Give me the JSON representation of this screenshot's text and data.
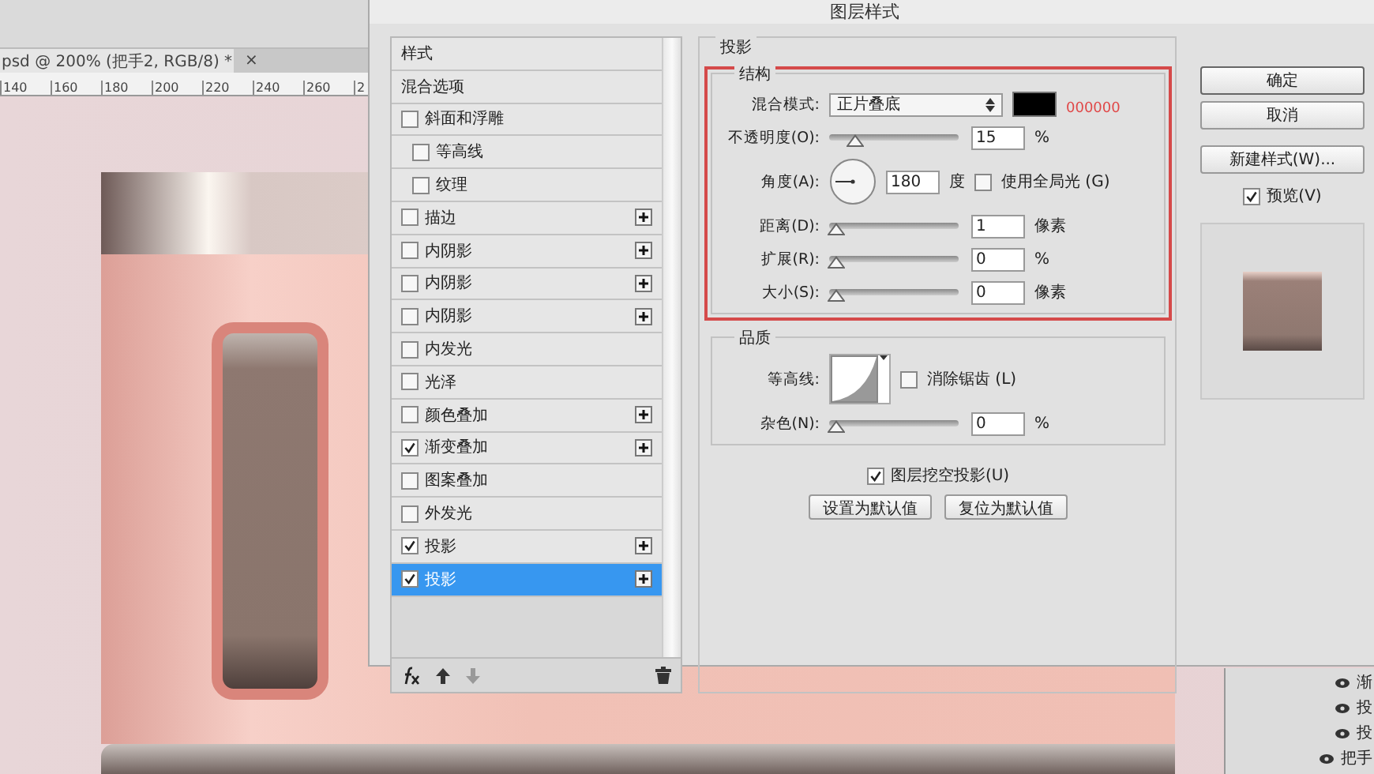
{
  "document": {
    "tab_title": "psd @ 200% (把手2, RGB/8) *",
    "tab_close": "×",
    "ruler_ticks": [
      "140",
      "160",
      "180",
      "200",
      "220",
      "240",
      "260",
      "2"
    ]
  },
  "layers_panel": {
    "rows": [
      {
        "label": "渐"
      },
      {
        "label": "投"
      },
      {
        "label": "投"
      },
      {
        "label": "把手"
      }
    ]
  },
  "dialog": {
    "title": "图层样式",
    "styles": [
      {
        "label": "样式",
        "kind": "header",
        "selected": false
      },
      {
        "label": "混合选项",
        "kind": "header",
        "selected": false
      },
      {
        "label": "斜面和浮雕",
        "kind": "check",
        "checked": false,
        "addable": false,
        "selected": false,
        "children": [
          {
            "label": "等高线",
            "kind": "check",
            "checked": false,
            "addable": false,
            "selected": false
          },
          {
            "label": "纹理",
            "kind": "check",
            "checked": false,
            "addable": false,
            "selected": false
          }
        ]
      },
      {
        "label": "描边",
        "kind": "check",
        "checked": false,
        "addable": true,
        "selected": false
      },
      {
        "label": "内阴影",
        "kind": "check",
        "checked": false,
        "addable": true,
        "selected": false
      },
      {
        "label": "内阴影",
        "kind": "check",
        "checked": false,
        "addable": true,
        "selected": false
      },
      {
        "label": "内阴影",
        "kind": "check",
        "checked": false,
        "addable": true,
        "selected": false
      },
      {
        "label": "内发光",
        "kind": "check",
        "checked": false,
        "addable": false,
        "selected": false
      },
      {
        "label": "光泽",
        "kind": "check",
        "checked": false,
        "addable": false,
        "selected": false
      },
      {
        "label": "颜色叠加",
        "kind": "check",
        "checked": false,
        "addable": true,
        "selected": false
      },
      {
        "label": "渐变叠加",
        "kind": "check",
        "checked": true,
        "addable": true,
        "selected": false
      },
      {
        "label": "图案叠加",
        "kind": "check",
        "checked": false,
        "addable": false,
        "selected": false
      },
      {
        "label": "外发光",
        "kind": "check",
        "checked": false,
        "addable": false,
        "selected": false
      },
      {
        "label": "投影",
        "kind": "check",
        "checked": true,
        "addable": true,
        "selected": false
      },
      {
        "label": "投影",
        "kind": "check",
        "checked": true,
        "addable": true,
        "selected": true
      }
    ],
    "section_title": "投影",
    "structure": {
      "title": "结构",
      "rows": [
        {
          "kind": "select",
          "label": "混合模式:",
          "value": "正片叠底",
          "note": "000000"
        },
        {
          "kind": "slider",
          "label": "不透明度(O):",
          "level": 0.15,
          "value": "15",
          "unit": "%"
        },
        {
          "kind": "angle",
          "label": "角度(A):",
          "value": "180",
          "unit": "度",
          "option": {
            "label": "使用全局光 (G)",
            "checked": false
          }
        },
        {
          "kind": "slider",
          "label": "距离(D):",
          "level": 0,
          "value": "1",
          "unit": "像素"
        },
        {
          "kind": "slider",
          "label": "扩展(R):",
          "level": 0,
          "value": "0",
          "unit": "%"
        },
        {
          "kind": "slider",
          "label": "大小(S):",
          "level": 0,
          "value": "0",
          "unit": "像素"
        }
      ]
    },
    "quality": {
      "title": "品质",
      "rows": [
        {
          "kind": "contour",
          "label": "等高线:",
          "option": {
            "label": "消除锯齿 (L)",
            "checked": false
          }
        },
        {
          "kind": "slider",
          "label": "杂色(N):",
          "level": 0,
          "value": "0",
          "unit": "%"
        }
      ]
    },
    "knockout": {
      "label": "图层挖空投影(U)",
      "checked": true
    },
    "default_buttons": [
      "设置为默认值",
      "复位为默认值"
    ],
    "buttons": [
      "确定",
      "取消",
      "新建样式(W)..."
    ],
    "preview": {
      "label": "预览(V)",
      "checked": true
    }
  }
}
